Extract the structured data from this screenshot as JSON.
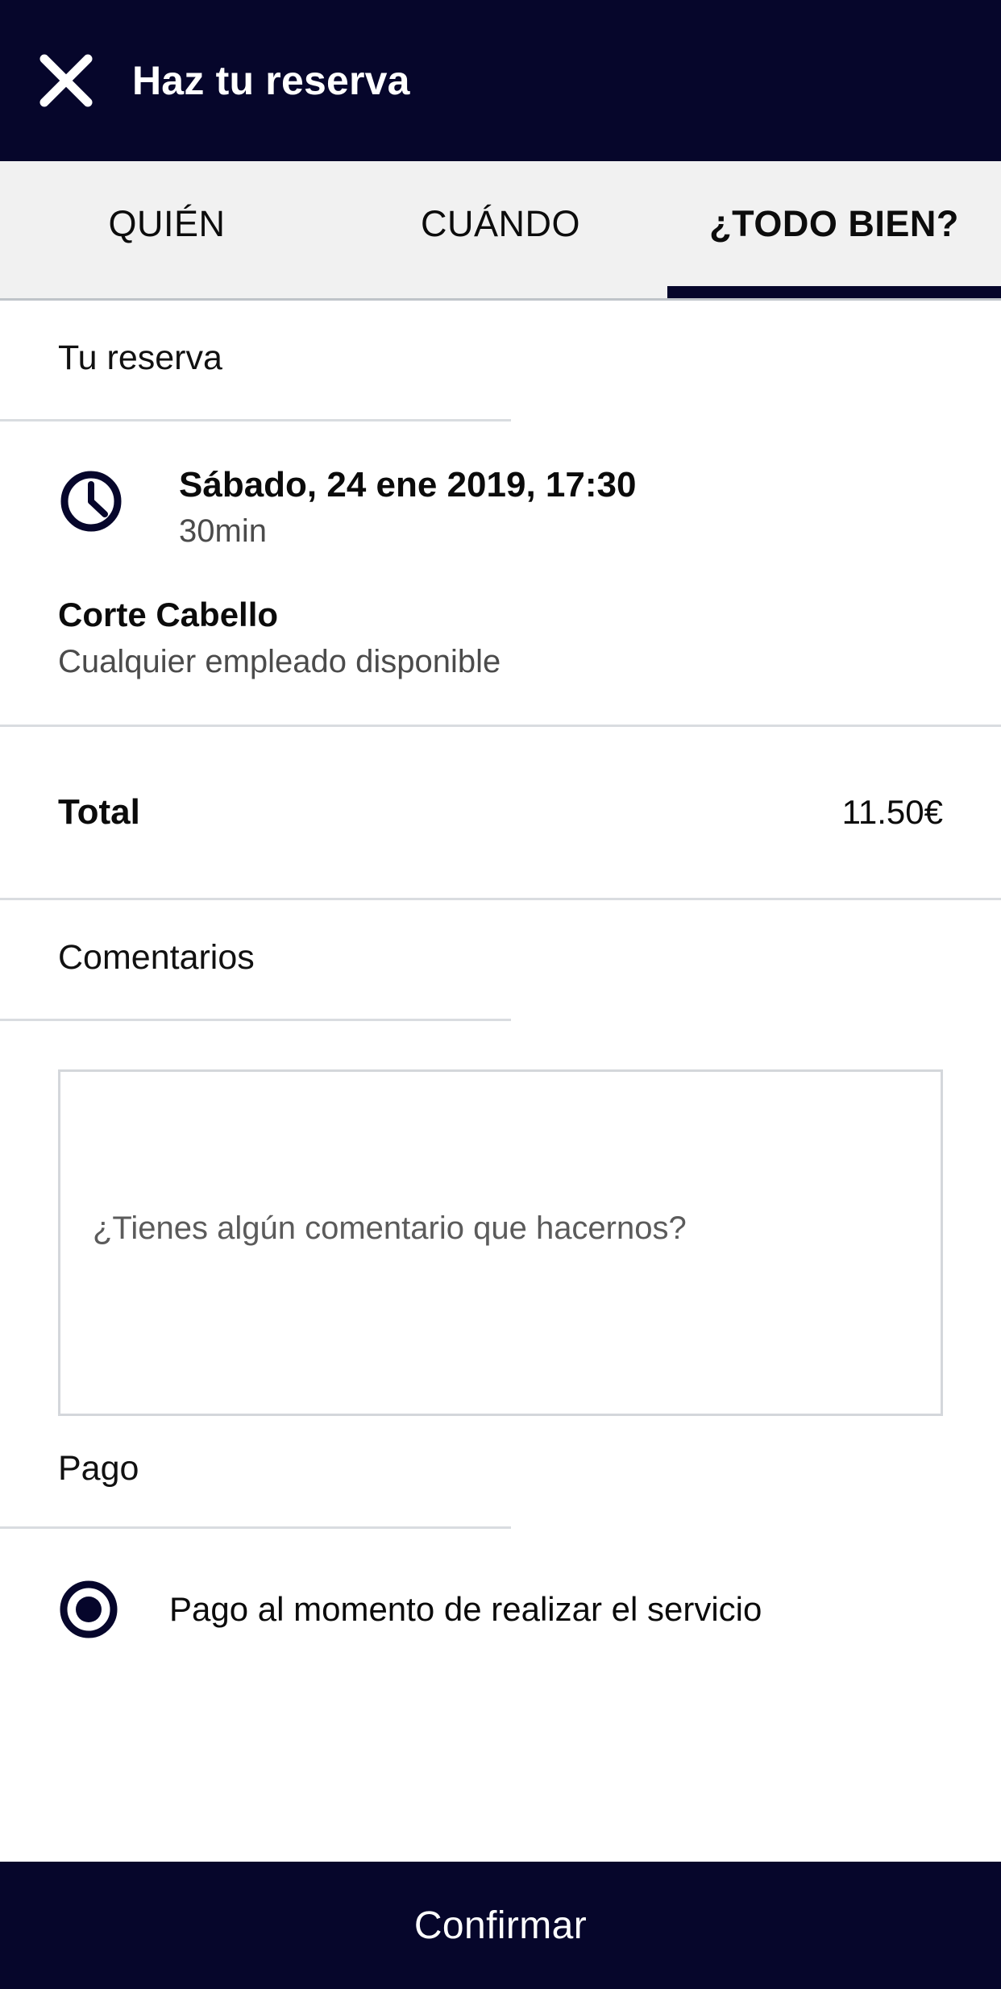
{
  "header": {
    "title": "Haz tu reserva",
    "close_icon": "close-icon"
  },
  "tabs": [
    {
      "label": "QUIÉN",
      "active": false
    },
    {
      "label": "CUÁNDO",
      "active": false
    },
    {
      "label": "¿TODO BIEN?",
      "active": true
    }
  ],
  "booking": {
    "section_title": "Tu reserva",
    "clock_icon": "clock-icon",
    "date": "Sábado, 24 ene 2019, 17:30",
    "duration": "30min",
    "service_name": "Corte Cabello",
    "staff": "Cualquier empleado disponible"
  },
  "total": {
    "label": "Total",
    "value": "11.50€"
  },
  "comments": {
    "section_title": "Comentarios",
    "placeholder": "¿Tienes algún comentario que hacernos?",
    "value": ""
  },
  "payment": {
    "section_title": "Pago",
    "option_label": "Pago al momento de realizar el servicio",
    "selected": true
  },
  "footer": {
    "confirm_label": "Confirmar"
  },
  "colors": {
    "brand_dark": "#06062b",
    "tabbar_bg": "#f1f1f1",
    "divider": "#d9dce0",
    "muted_text": "#4b4b4b",
    "body_text": "#0b0b0b"
  }
}
